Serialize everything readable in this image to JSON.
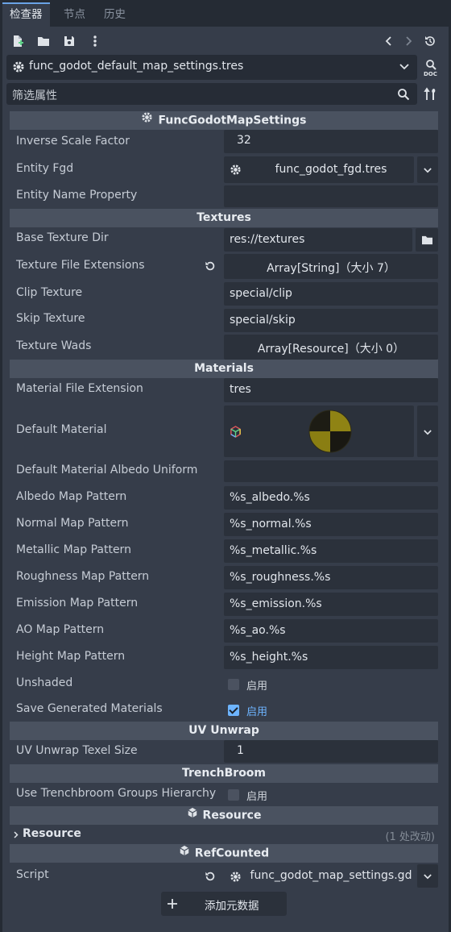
{
  "tabs": [
    "检查器",
    "节点",
    "历史"
  ],
  "toolbar": {
    "icons": [
      "new-resource-icon",
      "open-folder-icon",
      "save-icon",
      "more-icon",
      "back-icon",
      "forward-icon",
      "history-icon"
    ]
  },
  "resource_file": "func_godot_default_map_settings.tres",
  "filter_placeholder": "筛选属性",
  "header_title": "FuncGodotMapSettings",
  "props1": {
    "inverse_scale_label": "Inverse Scale Factor",
    "inverse_scale_value": "32",
    "entity_fgd_label": "Entity Fgd",
    "entity_fgd_value": "func_godot_fgd.tres",
    "entity_name_label": "Entity Name Property",
    "entity_name_value": ""
  },
  "textures": {
    "section": "Textures",
    "base_dir_label": "Base Texture Dir",
    "base_dir_value": "res://textures",
    "extensions_label": "Texture File Extensions",
    "extensions_value": "Array[String]（大小 7）",
    "clip_label": "Clip Texture",
    "clip_value": "special/clip",
    "skip_label": "Skip Texture",
    "skip_value": "special/skip",
    "wads_label": "Texture Wads",
    "wads_value": "Array[Resource]（大小 0）"
  },
  "materials": {
    "section": "Materials",
    "ext_label": "Material File Extension",
    "ext_value": "tres",
    "default_label": "Default Material",
    "albedo_uniform_label": "Default Material Albedo Uniform",
    "albedo_uniform_value": "",
    "albedo_label": "Albedo Map Pattern",
    "albedo_value": "%s_albedo.%s",
    "normal_label": "Normal Map Pattern",
    "normal_value": "%s_normal.%s",
    "metallic_label": "Metallic Map Pattern",
    "metallic_value": "%s_metallic.%s",
    "roughness_label": "Roughness Map Pattern",
    "roughness_value": "%s_roughness.%s",
    "emission_label": "Emission Map Pattern",
    "emission_value": "%s_emission.%s",
    "ao_label": "AO Map Pattern",
    "ao_value": "%s_ao.%s",
    "height_label": "Height Map Pattern",
    "height_value": "%s_height.%s",
    "unshaded_label": "Unshaded",
    "unshaded_checked": false,
    "save_label": "Save Generated Materials",
    "save_checked": true,
    "enable_text": "启用"
  },
  "uv": {
    "section": "UV Unwrap",
    "texel_label": "UV Unwrap Texel Size",
    "texel_value": "1"
  },
  "trenchbroom": {
    "section": "TrenchBroom",
    "groups_label": "Use Trenchbroom Groups Hierarchy",
    "groups_checked": false,
    "enable_text": "启用"
  },
  "resource": {
    "section": "Resource",
    "group_label": "Resource",
    "changes_text": "(1 处改动)"
  },
  "refcounted": {
    "section": "RefCounted",
    "script_label": "Script",
    "script_value": "func_godot_map_settings.gd"
  },
  "add_metadata_label": "添加元数据",
  "colors": {
    "accent": "#6db4ff",
    "panel": "#363d4a",
    "field": "#2b313b",
    "section": "#4a5260"
  }
}
